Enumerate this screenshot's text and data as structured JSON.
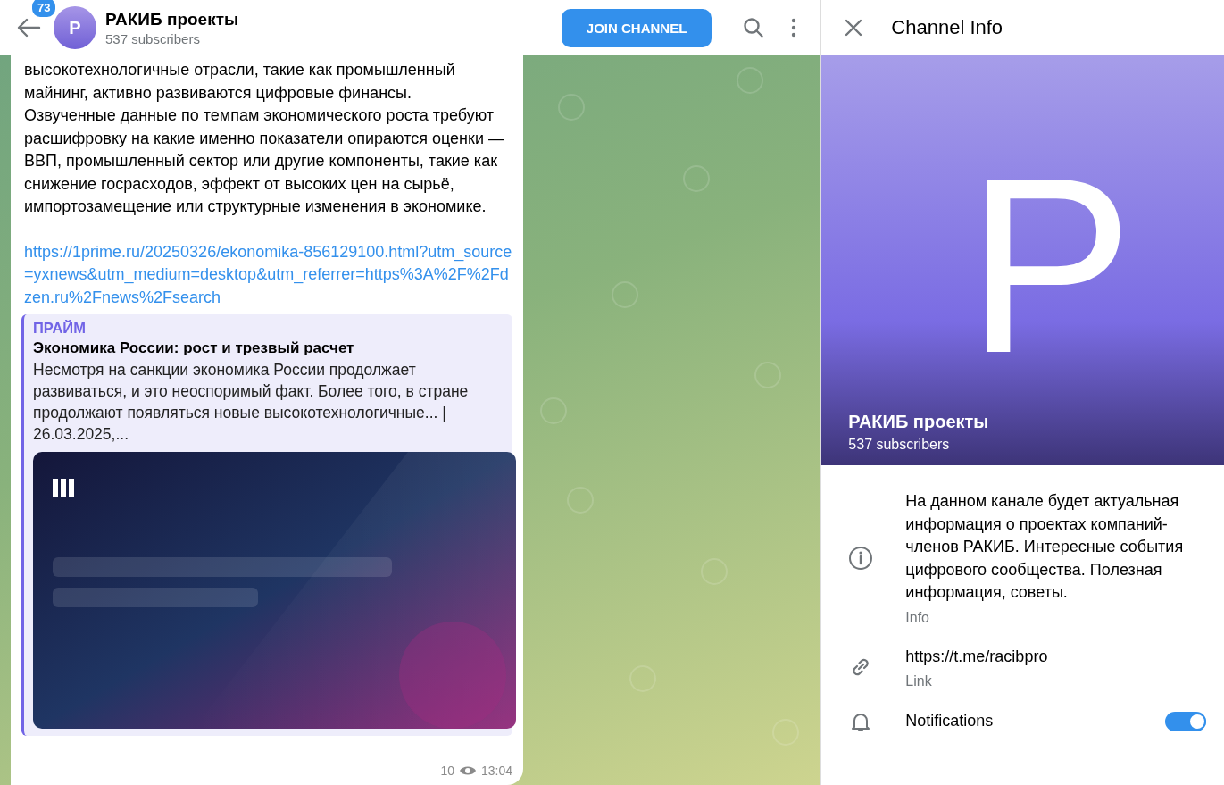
{
  "header": {
    "unread_count": "73",
    "avatar_letter": "P",
    "title": "РАКИБ проекты",
    "subtitle": "537 subscribers",
    "join_button": "JOIN CHANNEL"
  },
  "message": {
    "text": "высокотехнологичные отрасли, такие как промышленный майнинг, активно развиваются цифровые финансы. Озвученные данные по темпам экономического роста требуют расшифровку на какие именно показатели опираются оценки — ВВП, промышленный сектор или другие компоненты, такие как снижение госрасходов, эффект от высоких цен на сырьё, импортозамещение или структурные изменения в экономике.",
    "link": "https://1prime.ru/20250326/ekonomika-856129100.html?utm_source=yxnews&utm_medium=desktop&utm_referrer=https%3A%2F%2Fdzen.ru%2Fnews%2Fsearch",
    "preview": {
      "site": "ПРАЙМ",
      "title": "Экономика России: рост и трезвый расчет",
      "description": "Несмотря на санкции экономика России продолжает развиваться, и это неоспоримый факт. Более того, в стране продолжают появляться новые высокотехнологичные... | 26.03.2025,..."
    },
    "views": "10",
    "time": "13:04"
  },
  "info_panel": {
    "title": "Channel Info",
    "avatar_letter": "P",
    "name": "РАКИБ проекты",
    "subscribers": "537 subscribers",
    "rows": [
      {
        "kind": "info",
        "value": "На данном канале будет актуальная информация о проектах компаний-членов РАКИБ. Интересные события цифрового сообщества. Полезная информация, советы.",
        "label": "Info"
      },
      {
        "kind": "link",
        "value": "https://t.me/racibpro",
        "label": "Link"
      },
      {
        "kind": "toggle",
        "label": "Notifications",
        "on": true
      }
    ]
  }
}
